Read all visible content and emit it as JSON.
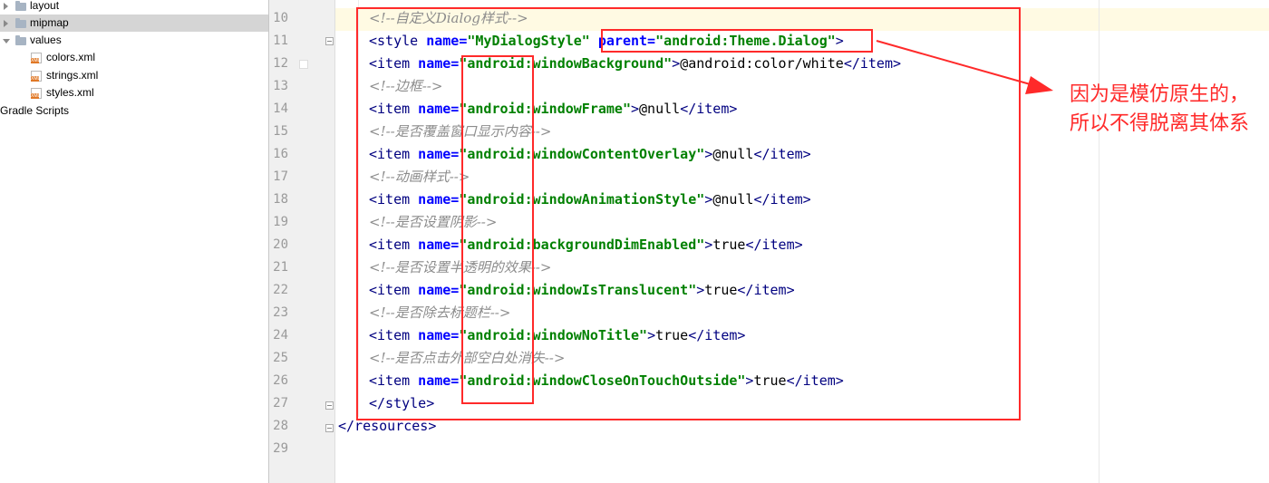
{
  "tree": {
    "items": [
      {
        "label": "layout"
      },
      {
        "label": "mipmap"
      },
      {
        "label": "values"
      },
      {
        "label": "colors.xml"
      },
      {
        "label": "strings.xml"
      },
      {
        "label": "styles.xml"
      },
      {
        "label": "Gradle Scripts"
      }
    ]
  },
  "editor": {
    "line_numbers": [
      "10",
      "11",
      "12",
      "13",
      "14",
      "15",
      "16",
      "17",
      "18",
      "19",
      "20",
      "21",
      "22",
      "23",
      "24",
      "25",
      "26",
      "27",
      "28",
      "29"
    ],
    "code": {
      "l10": "<!--自定义Dialog样式-->",
      "l11": {
        "t1": "<style",
        "a1": " name=",
        "v1": "\"MyDialogStyle\"",
        "a2": " parent=",
        "v2": "\"android:Theme.Dialog\"",
        "t2": ">"
      },
      "l12": {
        "t1": "<item",
        "a1": " name=",
        "v1": "\"android:windowBackground\"",
        "t2": ">",
        "x": "@android:color/white",
        "t3": "</item",
        "t4": ">"
      },
      "l13": "<!--边框-->",
      "l14": {
        "t1": "<item",
        "a1": " name=",
        "v1": "\"android:windowFrame\"",
        "t2": ">",
        "x": "@null",
        "t3": "</item",
        "t4": ">"
      },
      "l15": "<!--是否覆盖窗口显示内容-->",
      "l16": {
        "t1": "<item",
        "a1": " name=",
        "v1": "\"android:windowContentOverlay\"",
        "t2": ">",
        "x": "@null",
        "t3": "</item",
        "t4": ">"
      },
      "l17": "<!--动画样式-->",
      "l18": {
        "t1": "<item",
        "a1": " name=",
        "v1": "\"android:windowAnimationStyle\"",
        "t2": ">",
        "x": "@null",
        "t3": "</item",
        "t4": ">"
      },
      "l19": "<!--是否设置阴影-->",
      "l20": {
        "t1": "<item",
        "a1": " name=",
        "v1": "\"android:backgroundDimEnabled\"",
        "t2": ">",
        "x": "true",
        "t3": "</item",
        "t4": ">"
      },
      "l21": "<!--是否设置半透明的效果-->",
      "l22": {
        "t1": "<item",
        "a1": " name=",
        "v1": "\"android:windowIsTranslucent\"",
        "t2": ">",
        "x": "true",
        "t3": "</item",
        "t4": ">"
      },
      "l23": "<!--是否除去标题栏-->",
      "l24": {
        "t1": "<item",
        "a1": " name=",
        "v1": "\"android:windowNoTitle\"",
        "t2": ">",
        "x": "true",
        "t3": "</item",
        "t4": ">"
      },
      "l25": "<!--是否点击外部空白处消失-->",
      "l26": {
        "t1": "<item",
        "a1": " name=",
        "v1": "\"android:windowCloseOnTouchOutside\"",
        "t2": ">",
        "x": "true",
        "t3": "</item",
        "t4": ">"
      },
      "l27": {
        "t1": "</style",
        "t2": ">"
      },
      "l28": {
        "t1": "</resources",
        "t2": ">"
      }
    }
  },
  "annotation": {
    "note": "因为是模仿原生的，所以不得脱离其体系",
    "color": "#ff2a2a"
  }
}
